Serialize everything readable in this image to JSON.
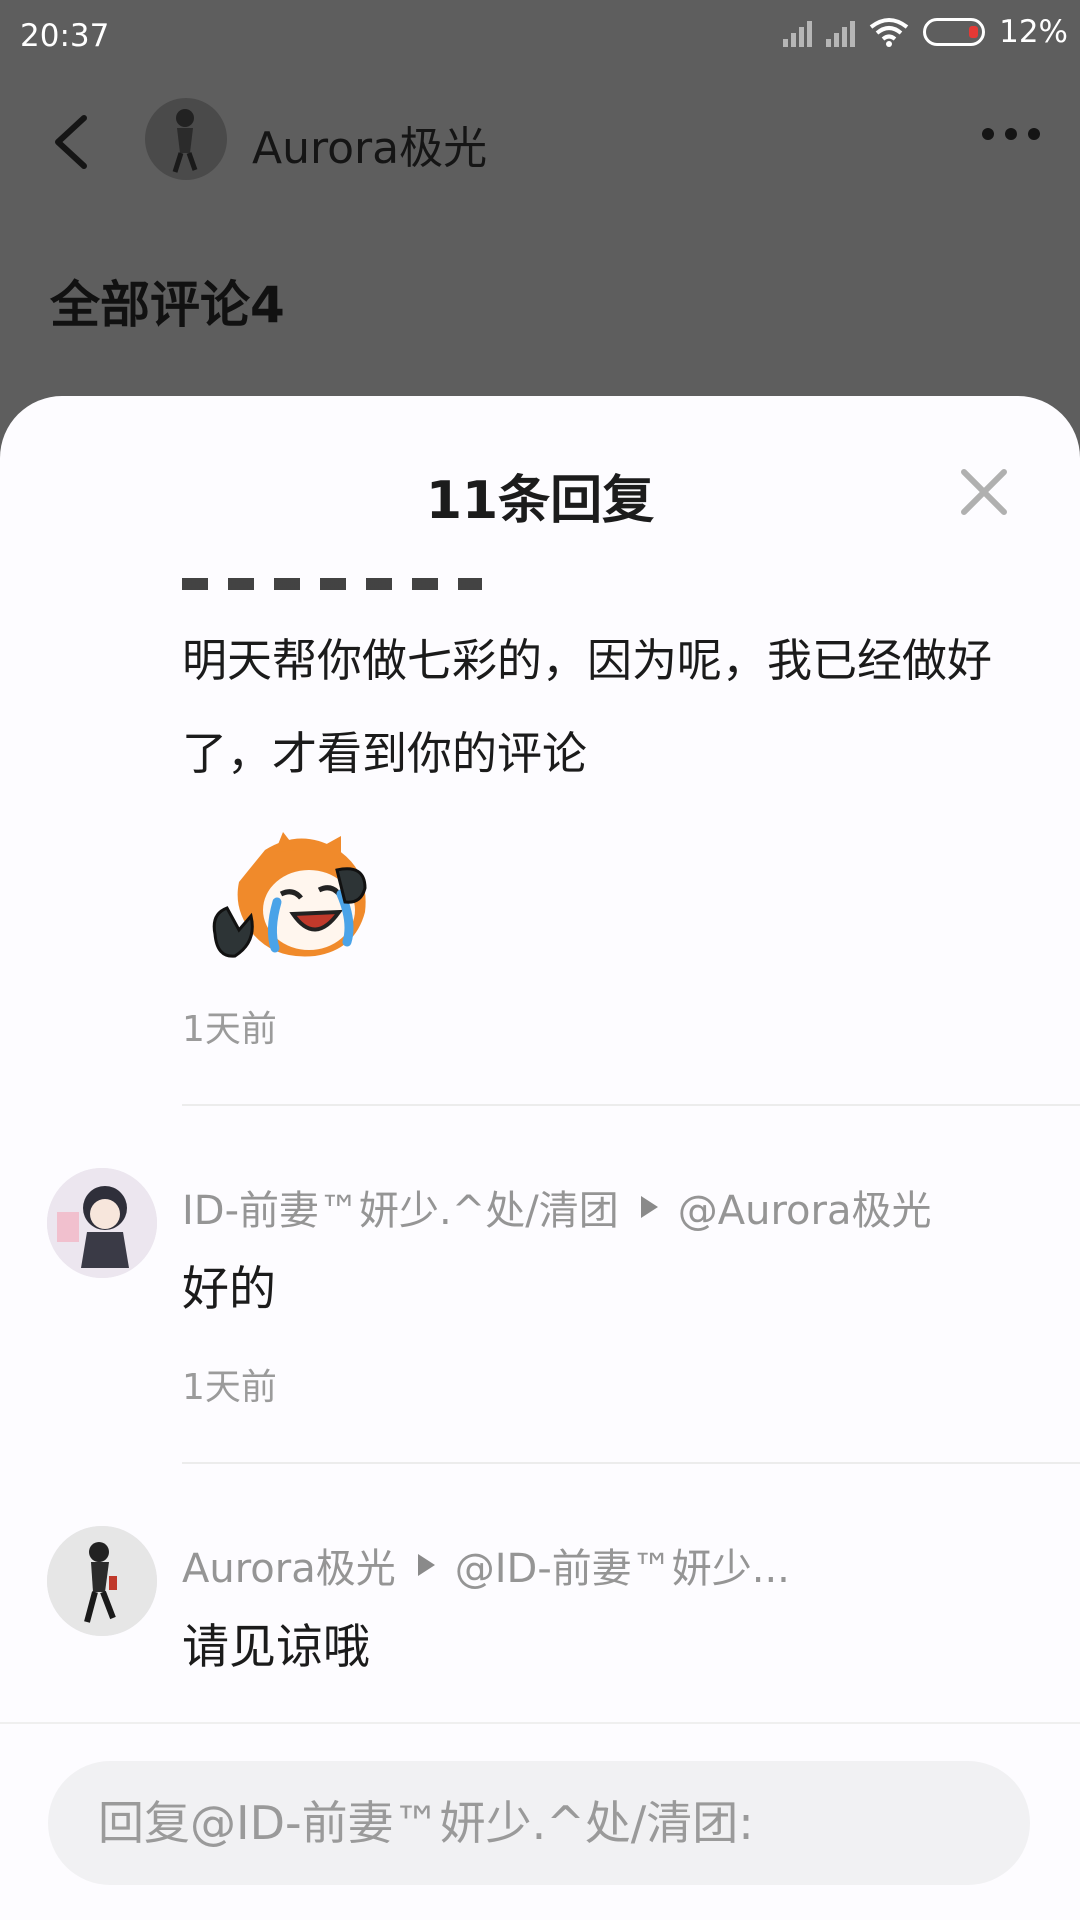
{
  "status_bar": {
    "time": "20:37",
    "battery": "12%"
  },
  "top_nav": {
    "title": "Aurora极光"
  },
  "section": {
    "title": "全部评论4"
  },
  "sheet": {
    "title": "11条回复",
    "first_comment": {
      "text": "明天帮你做七彩的，因为呢，我已经做好了，才看到你的评论",
      "time": "1天前"
    },
    "replies": [
      {
        "author": "ID-前妻™妍少.^处/清团",
        "reply_to": "@Aurora极光",
        "text": "好的",
        "time": "1天前"
      },
      {
        "author": "Aurora极光",
        "reply_to": "@ID-前妻™妍少...",
        "text": "请见谅哦"
      }
    ]
  },
  "input": {
    "placeholder": "回复@ID-前妻™妍少.^处/清团:"
  }
}
